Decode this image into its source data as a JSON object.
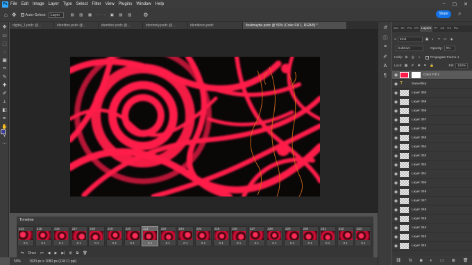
{
  "menubar": {
    "items": [
      "File",
      "Edit",
      "Image",
      "Layer",
      "Type",
      "Select",
      "Filter",
      "View",
      "Plugins",
      "Window",
      "Help"
    ],
    "logo": "Ps"
  },
  "options": {
    "auto_select_label": "Auto-Select:",
    "auto_select_value": "Layer",
    "share_label": "Share"
  },
  "tabs": [
    "digital_1.psdc @...",
    "identitoo.psdc @...",
    "identdoc.psdc @...",
    "identonly.psdc @...",
    "identitooo.psdc",
    "finalmaybe.psdc @ 50% (Color Fill 1, RGB/8) *"
  ],
  "timeline": {
    "title": "Timeline",
    "loop": "Once",
    "frames": [
      {
        "num": "214",
        "delay": "0.1"
      },
      {
        "num": "215",
        "delay": "0.1"
      },
      {
        "num": "216",
        "delay": "0.1"
      },
      {
        "num": "217",
        "delay": "0.1"
      },
      {
        "num": "218",
        "delay": "0.1"
      },
      {
        "num": "219",
        "delay": "0.1"
      },
      {
        "num": "220",
        "delay": "0.1"
      },
      {
        "num": "221",
        "delay": "0.1"
      },
      {
        "num": "222",
        "delay": "0.1"
      },
      {
        "num": "223",
        "delay": "0.1"
      },
      {
        "num": "224",
        "delay": "0.1"
      },
      {
        "num": "225",
        "delay": "0.1"
      },
      {
        "num": "226",
        "delay": "0.1"
      },
      {
        "num": "227",
        "delay": "0.1"
      },
      {
        "num": "228",
        "delay": "0.1"
      },
      {
        "num": "229",
        "delay": "0.1"
      },
      {
        "num": "230",
        "delay": "0.1"
      },
      {
        "num": "231",
        "delay": "0.1"
      },
      {
        "num": "232",
        "delay": "0.1"
      },
      {
        "num": "233",
        "delay": "0.1"
      }
    ],
    "selected_frame": "221"
  },
  "status": {
    "zoom": "50%",
    "doc_size": "1920 px x 1080 px (118.11 ppi)"
  },
  "panel": {
    "tabs": [
      "Sw",
      "Gr",
      "Pa",
      "Ch",
      "Layers",
      "Pr",
      "Ad",
      "Cs",
      "Pa"
    ],
    "active_tab": "Layers",
    "kind_label": "Kind",
    "blend_mode": "Subtract",
    "opacity_label": "Opacity:",
    "opacity_value": "0%",
    "unify_label": "Unify:",
    "propagate_label": "Propagate Frame 1",
    "lock_label": "Lock:",
    "fill_label": "Fill:",
    "fill_value": "100%",
    "layers": [
      "Color Fill 1",
      "Sanushka",
      "Layer 360",
      "Layer 359",
      "Layer 358",
      "Layer 357",
      "Layer 356",
      "Layer 355",
      "Layer 354",
      "Layer 353",
      "Layer 352",
      "Layer 351",
      "Layer 350",
      "Layer 349",
      "Layer 347",
      "Layer 346",
      "Layer 345",
      "Layer 344",
      "Layer 343",
      "Layer 342"
    ]
  },
  "colors": {
    "accent": "#1473e6",
    "artwork_red": "#ff1a4a",
    "artwork_orange": "#d66a1a"
  }
}
